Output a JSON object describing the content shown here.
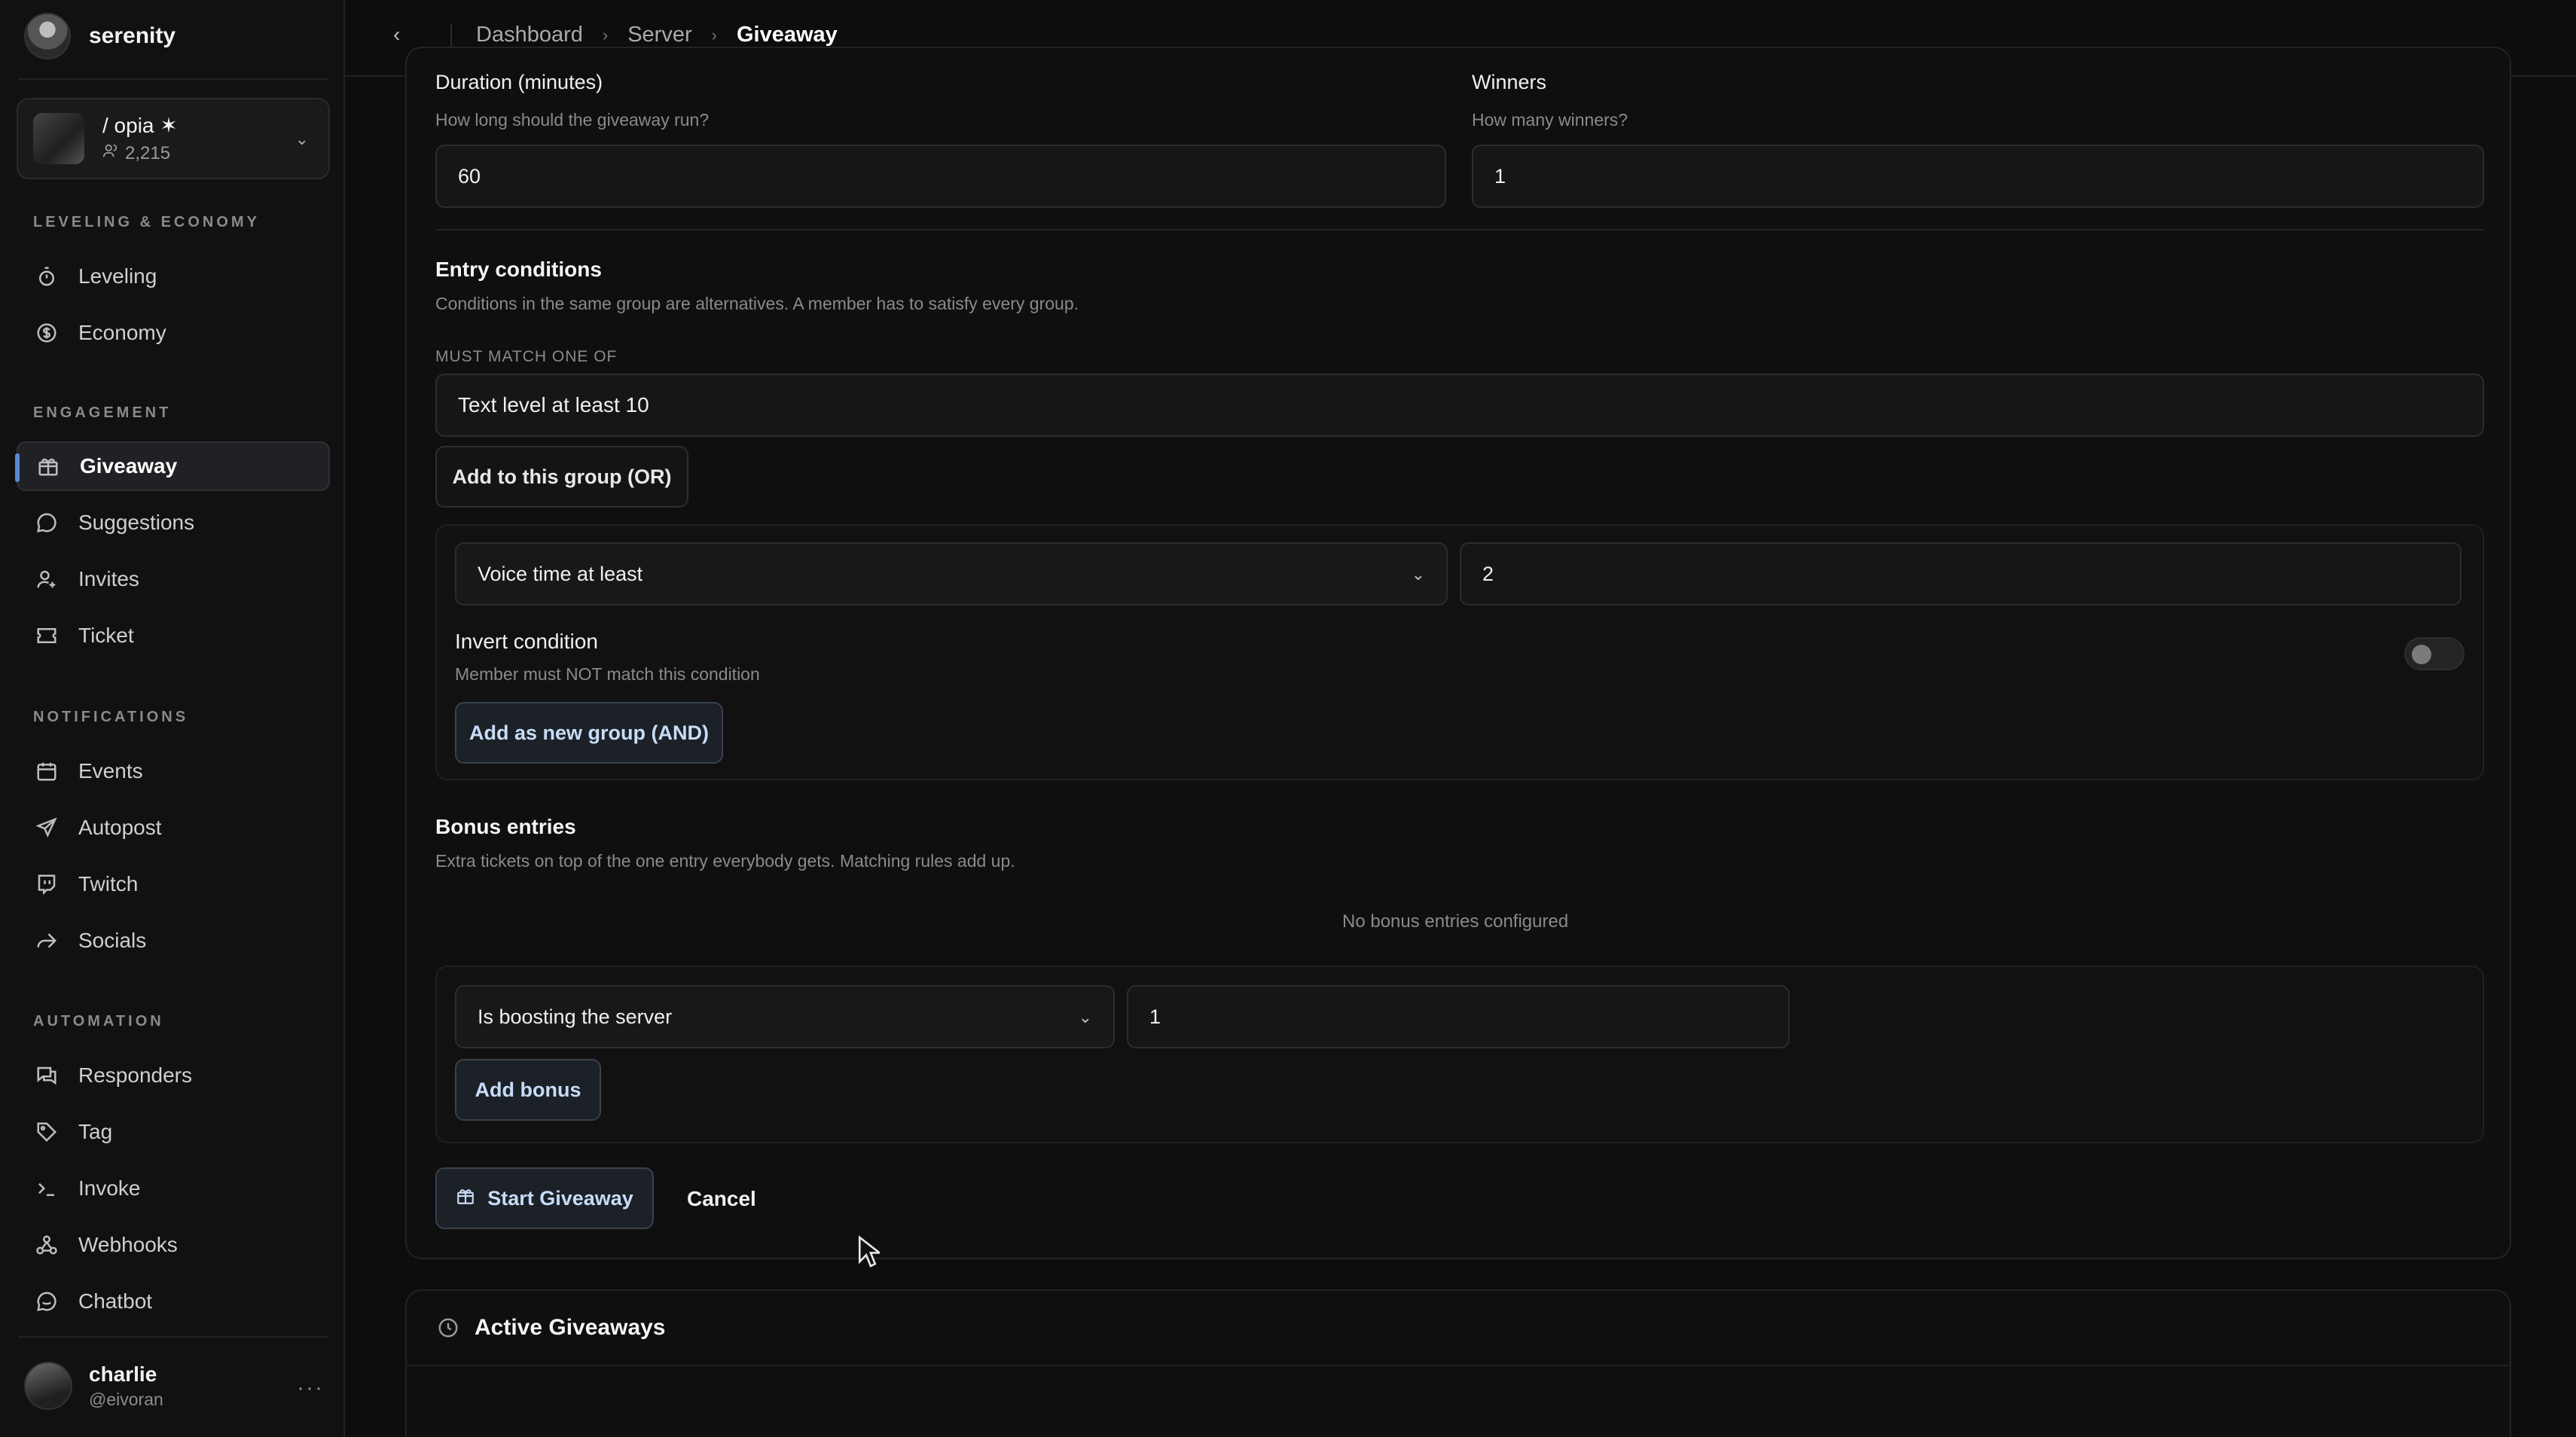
{
  "app": {
    "name": "serenity"
  },
  "server": {
    "name": "/ opia ✶",
    "member_count": "2,215"
  },
  "sidebar": {
    "sections": [
      {
        "label": "LEVELING & ECONOMY",
        "items": [
          {
            "label": "Leveling",
            "icon": "stopwatch-icon"
          },
          {
            "label": "Economy",
            "icon": "coin-icon"
          }
        ]
      },
      {
        "label": "ENGAGEMENT",
        "items": [
          {
            "label": "Giveaway",
            "icon": "gift-icon",
            "active": true
          },
          {
            "label": "Suggestions",
            "icon": "chat-bubble-icon"
          },
          {
            "label": "Invites",
            "icon": "user-plus-icon"
          },
          {
            "label": "Ticket",
            "icon": "ticket-icon"
          }
        ]
      },
      {
        "label": "NOTIFICATIONS",
        "items": [
          {
            "label": "Events",
            "icon": "calendar-icon"
          },
          {
            "label": "Autopost",
            "icon": "send-icon"
          },
          {
            "label": "Twitch",
            "icon": "twitch-icon"
          },
          {
            "label": "Socials",
            "icon": "share-icon"
          }
        ]
      },
      {
        "label": "AUTOMATION",
        "items": [
          {
            "label": "Responders",
            "icon": "messages-icon"
          },
          {
            "label": "Tag",
            "icon": "tag-icon"
          },
          {
            "label": "Invoke",
            "icon": "terminal-icon"
          },
          {
            "label": "Webhooks",
            "icon": "webhook-icon"
          },
          {
            "label": "Chatbot",
            "icon": "bot-chat-icon"
          }
        ]
      }
    ]
  },
  "user": {
    "name": "charlie",
    "handle": "@eivoran"
  },
  "breadcrumb": {
    "items": [
      "Dashboard",
      "Server",
      "Giveaway"
    ]
  },
  "form": {
    "duration": {
      "label": "Duration (minutes)",
      "hint": "How long should the giveaway run?",
      "value": "60"
    },
    "winners": {
      "label": "Winners",
      "hint": "How many winners?",
      "value": "1"
    },
    "entry": {
      "heading": "Entry conditions",
      "description": "Conditions in the same group are alternatives. A member has to satisfy every group.",
      "group_label": "MUST MATCH ONE OF",
      "existing_condition": "Text level at least 10",
      "add_or_label": "Add to this group (OR)",
      "new_condition_type": "Voice time at least",
      "new_condition_value": "2",
      "invert_label": "Invert condition",
      "invert_hint": "Member must NOT match this condition",
      "invert_enabled": false,
      "add_and_label": "Add as new group (AND)"
    },
    "bonus": {
      "heading": "Bonus entries",
      "description": "Extra tickets on top of the one entry everybody gets. Matching rules add up.",
      "empty_note": "No bonus entries configured",
      "rule_type": "Is boosting the server",
      "rule_value": "1",
      "add_label": "Add bonus"
    },
    "start_label": "Start Giveaway",
    "cancel_label": "Cancel"
  },
  "active_giveaways": {
    "title": "Active Giveaways"
  },
  "colors": {
    "accent": "#5a8ad6",
    "button_blue_text": "#c8dcf6",
    "background": "#0d0d0d"
  }
}
